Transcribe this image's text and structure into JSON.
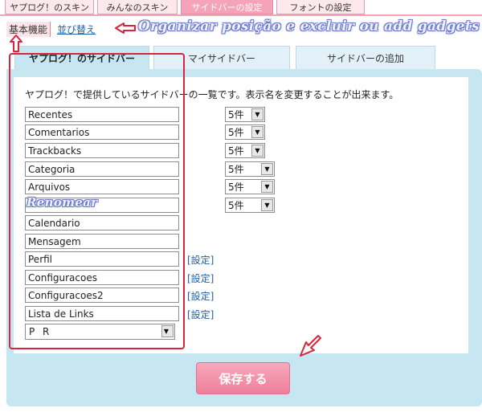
{
  "top_tabs": [
    {
      "label": "ヤプログ！のスキン",
      "active": false
    },
    {
      "label": "みんなのスキン",
      "active": false
    },
    {
      "label": "サイドバーの設定",
      "active": true
    },
    {
      "label": "フォントの設定",
      "active": false
    }
  ],
  "subnav": {
    "active": "基本機能",
    "link": "並び替え"
  },
  "annotations": {
    "top": "Organizar posição e excluir ou add gadgets",
    "rename": "Renomear"
  },
  "main_tabs": [
    {
      "label": "ヤプログ！のサイドバー",
      "active": true
    },
    {
      "label": "マイサイドバー",
      "active": false
    },
    {
      "label": "サイドバーの追加",
      "active": false
    }
  ],
  "description": "ヤプログ！で提供しているサイドバーの一覧です。表示名を変更することが出来ます。",
  "sidebar_items": [
    {
      "value": "Recentes",
      "count": "5件",
      "settings": ""
    },
    {
      "value": "Comentarios",
      "count": "5件",
      "settings": ""
    },
    {
      "value": "Trackbacks",
      "count": "5件",
      "settings": ""
    },
    {
      "value": "Categoria",
      "count": "5件",
      "settings": ""
    },
    {
      "value": "Arquivos",
      "count": "5件",
      "settings": ""
    },
    {
      "value": "",
      "count": "5件",
      "settings": ""
    },
    {
      "value": "Calendario",
      "count": "",
      "settings": ""
    },
    {
      "value": "Mensagem",
      "count": "",
      "settings": ""
    },
    {
      "value": "Perfil",
      "count": "",
      "settings": "[設定]"
    },
    {
      "value": "Configuracoes",
      "count": "",
      "settings": "[設定]"
    },
    {
      "value": "Configuracoes2",
      "count": "",
      "settings": "[設定]"
    },
    {
      "value": "Lista de Links",
      "count": "",
      "settings": "[設定]"
    }
  ],
  "pr_select": {
    "value": "P R"
  },
  "save_button": {
    "label": "保存する"
  },
  "colors": {
    "accent_pink": "#f4a3b8",
    "panel_blue": "#c6e6f1",
    "link_blue": "#1f5fa0",
    "highlight_red": "#d8243e"
  }
}
